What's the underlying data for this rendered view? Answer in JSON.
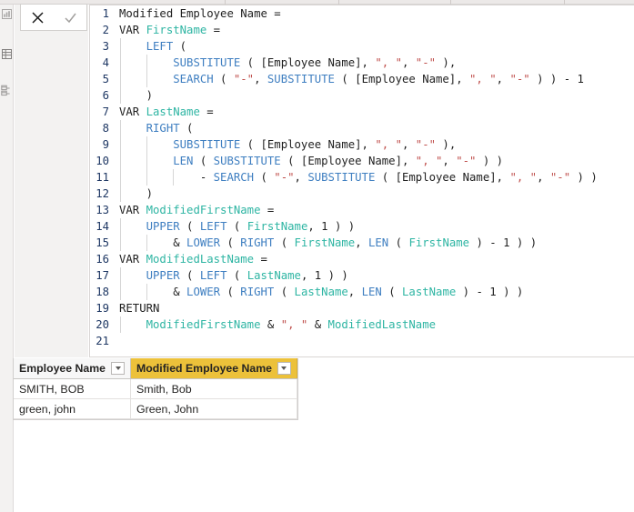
{
  "window": {
    "app": "Power BI Desktop",
    "context": "DAX formula editor"
  },
  "formula_toolbar": {
    "cancel": {
      "icon": "close-icon",
      "label": "Cancel",
      "color": "#1b1b1b"
    },
    "commit": {
      "icon": "checkmark-icon",
      "label": "Commit",
      "color": "#a19f9d"
    }
  },
  "view_rail": {
    "items": [
      {
        "icon": "report-view-icon",
        "label": "Report view"
      },
      {
        "icon": "data-view-icon",
        "label": "Data view"
      },
      {
        "icon": "model-view-icon",
        "label": "Model view"
      }
    ]
  },
  "editor": {
    "language": "DAX",
    "total_lines": 21,
    "colors": {
      "function": "#3f7fc1",
      "variable": "#2eb5a3",
      "string": "#c0504d",
      "keyword": "#1f1f1f",
      "line_number": "#1f3864"
    },
    "lines": [
      {
        "n": "1",
        "indent": 0,
        "tokens": [
          {
            "t": "Modified Employee Name =",
            "c": "kw"
          }
        ]
      },
      {
        "n": "2",
        "indent": 0,
        "tokens": [
          {
            "t": "VAR ",
            "c": "kw"
          },
          {
            "t": "FirstName",
            "c": "var"
          },
          {
            "t": " =",
            "c": "pun"
          }
        ]
      },
      {
        "n": "3",
        "indent": 1,
        "tokens": [
          {
            "t": "    ",
            "c": "pun"
          },
          {
            "t": "LEFT",
            "c": "fn"
          },
          {
            "t": " (",
            "c": "pun"
          }
        ]
      },
      {
        "n": "4",
        "indent": 2,
        "tokens": [
          {
            "t": "        ",
            "c": "pun"
          },
          {
            "t": "SUBSTITUTE",
            "c": "fn"
          },
          {
            "t": " ( [Employee Name], ",
            "c": "pun"
          },
          {
            "t": "\", \"",
            "c": "str"
          },
          {
            "t": ", ",
            "c": "pun"
          },
          {
            "t": "\"-\"",
            "c": "str"
          },
          {
            "t": " ),",
            "c": "pun"
          }
        ]
      },
      {
        "n": "5",
        "indent": 2,
        "tokens": [
          {
            "t": "        ",
            "c": "pun"
          },
          {
            "t": "SEARCH",
            "c": "fn"
          },
          {
            "t": " ( ",
            "c": "pun"
          },
          {
            "t": "\"-\"",
            "c": "str"
          },
          {
            "t": ", ",
            "c": "pun"
          },
          {
            "t": "SUBSTITUTE",
            "c": "fn"
          },
          {
            "t": " ( [Employee Name], ",
            "c": "pun"
          },
          {
            "t": "\", \"",
            "c": "str"
          },
          {
            "t": ", ",
            "c": "pun"
          },
          {
            "t": "\"-\"",
            "c": "str"
          },
          {
            "t": " ) ) - 1",
            "c": "pun"
          }
        ]
      },
      {
        "n": "6",
        "indent": 1,
        "tokens": [
          {
            "t": "    )",
            "c": "pun"
          }
        ]
      },
      {
        "n": "7",
        "indent": 0,
        "tokens": [
          {
            "t": "VAR ",
            "c": "kw"
          },
          {
            "t": "LastName",
            "c": "var"
          },
          {
            "t": " =",
            "c": "pun"
          }
        ]
      },
      {
        "n": "8",
        "indent": 1,
        "tokens": [
          {
            "t": "    ",
            "c": "pun"
          },
          {
            "t": "RIGHT",
            "c": "fn"
          },
          {
            "t": " (",
            "c": "pun"
          }
        ]
      },
      {
        "n": "9",
        "indent": 2,
        "tokens": [
          {
            "t": "        ",
            "c": "pun"
          },
          {
            "t": "SUBSTITUTE",
            "c": "fn"
          },
          {
            "t": " ( [Employee Name], ",
            "c": "pun"
          },
          {
            "t": "\", \"",
            "c": "str"
          },
          {
            "t": ", ",
            "c": "pun"
          },
          {
            "t": "\"-\"",
            "c": "str"
          },
          {
            "t": " ),",
            "c": "pun"
          }
        ]
      },
      {
        "n": "10",
        "indent": 2,
        "tokens": [
          {
            "t": "        ",
            "c": "pun"
          },
          {
            "t": "LEN",
            "c": "fn"
          },
          {
            "t": " ( ",
            "c": "pun"
          },
          {
            "t": "SUBSTITUTE",
            "c": "fn"
          },
          {
            "t": " ( [Employee Name], ",
            "c": "pun"
          },
          {
            "t": "\", \"",
            "c": "str"
          },
          {
            "t": ", ",
            "c": "pun"
          },
          {
            "t": "\"-\"",
            "c": "str"
          },
          {
            "t": " ) )",
            "c": "pun"
          }
        ]
      },
      {
        "n": "11",
        "indent": 3,
        "tokens": [
          {
            "t": "            - ",
            "c": "pun"
          },
          {
            "t": "SEARCH",
            "c": "fn"
          },
          {
            "t": " ( ",
            "c": "pun"
          },
          {
            "t": "\"-\"",
            "c": "str"
          },
          {
            "t": ", ",
            "c": "pun"
          },
          {
            "t": "SUBSTITUTE",
            "c": "fn"
          },
          {
            "t": " ( [Employee Name], ",
            "c": "pun"
          },
          {
            "t": "\", \"",
            "c": "str"
          },
          {
            "t": ", ",
            "c": "pun"
          },
          {
            "t": "\"-\"",
            "c": "str"
          },
          {
            "t": " ) )",
            "c": "pun"
          }
        ]
      },
      {
        "n": "12",
        "indent": 1,
        "tokens": [
          {
            "t": "    )",
            "c": "pun"
          }
        ]
      },
      {
        "n": "13",
        "indent": 0,
        "tokens": [
          {
            "t": "VAR ",
            "c": "kw"
          },
          {
            "t": "ModifiedFirstName",
            "c": "var"
          },
          {
            "t": " =",
            "c": "pun"
          }
        ]
      },
      {
        "n": "14",
        "indent": 1,
        "tokens": [
          {
            "t": "    ",
            "c": "pun"
          },
          {
            "t": "UPPER",
            "c": "fn"
          },
          {
            "t": " ( ",
            "c": "pun"
          },
          {
            "t": "LEFT",
            "c": "fn"
          },
          {
            "t": " ( ",
            "c": "pun"
          },
          {
            "t": "FirstName",
            "c": "var"
          },
          {
            "t": ", 1 ) )",
            "c": "pun"
          }
        ]
      },
      {
        "n": "15",
        "indent": 2,
        "tokens": [
          {
            "t": "        & ",
            "c": "pun"
          },
          {
            "t": "LOWER",
            "c": "fn"
          },
          {
            "t": " ( ",
            "c": "pun"
          },
          {
            "t": "RIGHT",
            "c": "fn"
          },
          {
            "t": " ( ",
            "c": "pun"
          },
          {
            "t": "FirstName",
            "c": "var"
          },
          {
            "t": ", ",
            "c": "pun"
          },
          {
            "t": "LEN",
            "c": "fn"
          },
          {
            "t": " ( ",
            "c": "pun"
          },
          {
            "t": "FirstName",
            "c": "var"
          },
          {
            "t": " ) - 1 ) )",
            "c": "pun"
          }
        ]
      },
      {
        "n": "16",
        "indent": 0,
        "tokens": [
          {
            "t": "VAR ",
            "c": "kw"
          },
          {
            "t": "ModifiedLastName",
            "c": "var"
          },
          {
            "t": " =",
            "c": "pun"
          }
        ]
      },
      {
        "n": "17",
        "indent": 1,
        "tokens": [
          {
            "t": "    ",
            "c": "pun"
          },
          {
            "t": "UPPER",
            "c": "fn"
          },
          {
            "t": " ( ",
            "c": "pun"
          },
          {
            "t": "LEFT",
            "c": "fn"
          },
          {
            "t": " ( ",
            "c": "pun"
          },
          {
            "t": "LastName",
            "c": "var"
          },
          {
            "t": ", 1 ) )",
            "c": "pun"
          }
        ]
      },
      {
        "n": "18",
        "indent": 2,
        "tokens": [
          {
            "t": "        & ",
            "c": "pun"
          },
          {
            "t": "LOWER",
            "c": "fn"
          },
          {
            "t": " ( ",
            "c": "pun"
          },
          {
            "t": "RIGHT",
            "c": "fn"
          },
          {
            "t": " ( ",
            "c": "pun"
          },
          {
            "t": "LastName",
            "c": "var"
          },
          {
            "t": ", ",
            "c": "pun"
          },
          {
            "t": "LEN",
            "c": "fn"
          },
          {
            "t": " ( ",
            "c": "pun"
          },
          {
            "t": "LastName",
            "c": "var"
          },
          {
            "t": " ) - 1 ) )",
            "c": "pun"
          }
        ]
      },
      {
        "n": "19",
        "indent": 0,
        "tokens": [
          {
            "t": "RETURN",
            "c": "kw"
          }
        ]
      },
      {
        "n": "20",
        "indent": 1,
        "tokens": [
          {
            "t": "    ",
            "c": "pun"
          },
          {
            "t": "ModifiedFirstName",
            "c": "var"
          },
          {
            "t": " & ",
            "c": "pun"
          },
          {
            "t": "\", \"",
            "c": "str"
          },
          {
            "t": " & ",
            "c": "pun"
          },
          {
            "t": "ModifiedLastName",
            "c": "var"
          }
        ]
      },
      {
        "n": "21",
        "indent": 0,
        "tokens": []
      }
    ]
  },
  "preview_table": {
    "header_highlight_color": "#ecc13a",
    "columns": [
      {
        "label": "Employee Name",
        "highlighted": false,
        "filter_icon": "chevron-down-icon"
      },
      {
        "label": "Modified Employee Name",
        "highlighted": true,
        "filter_icon": "chevron-down-icon"
      }
    ],
    "rows": [
      {
        "employee_name": "SMITH, BOB",
        "modified_employee_name": "Smith, Bob"
      },
      {
        "employee_name": "green, john",
        "modified_employee_name": "Green, John"
      }
    ]
  }
}
